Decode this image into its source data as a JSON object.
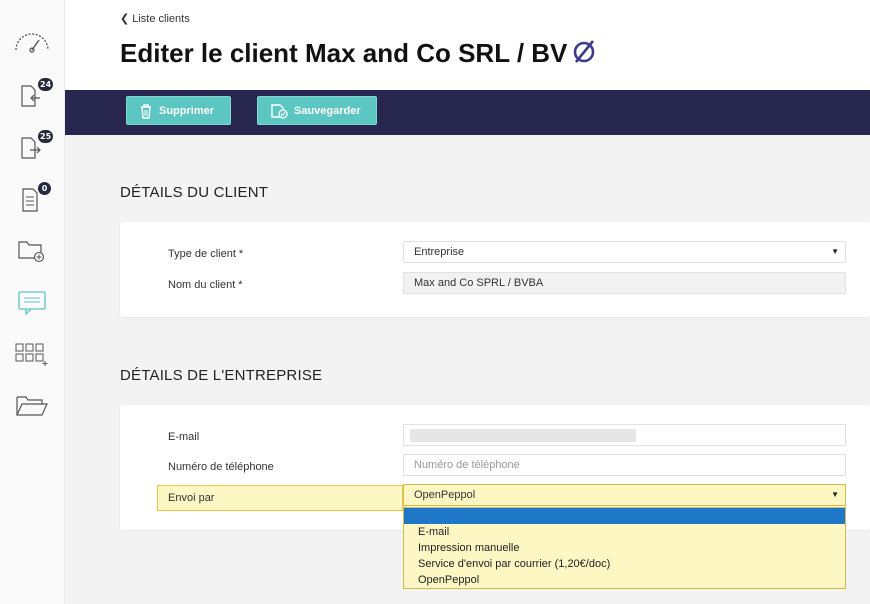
{
  "sidebar": {
    "items": [
      {
        "icon": "speedometer-icon",
        "badge": ""
      },
      {
        "icon": "inbox-document-icon",
        "badge": "24"
      },
      {
        "icon": "outbox-document-icon",
        "badge": "25"
      },
      {
        "icon": "list-document-icon",
        "badge": "0"
      },
      {
        "icon": "add-folder-icon",
        "badge": ""
      },
      {
        "icon": "chat-icon",
        "badge": ""
      },
      {
        "icon": "grid-add-icon",
        "badge": ""
      },
      {
        "icon": "open-folder-icon",
        "badge": ""
      }
    ]
  },
  "header": {
    "back_label": "Liste clients",
    "title": "Editer le client Max and Co SRL / BV"
  },
  "toolbar": {
    "delete_label": "Supprimer",
    "save_label": "Sauvegarder"
  },
  "client_section": {
    "title": "DÉTAILS DU CLIENT",
    "type_label": "Type de client *",
    "type_value": "Entreprise",
    "name_label": "Nom du client *",
    "name_value": "Max and Co SPRL / BVBA"
  },
  "company_section": {
    "title": "DÉTAILS DE L'ENTREPRISE",
    "email_label": "E-mail",
    "phone_label": "Numéro de téléphone",
    "phone_placeholder": "Numéro de téléphone",
    "send_label": "Envoi par",
    "send_value": "OpenPeppol",
    "send_options": [
      "E-mail",
      "Impression manuelle",
      "Service d'envoi par courrier (1,20€/doc)",
      "OpenPeppol"
    ]
  },
  "colors": {
    "toolbar_bg": "#27264e",
    "button_bg": "#5cc6c3",
    "highlight": "#fdf7c4",
    "dropdown_selected": "#1f77c8"
  }
}
